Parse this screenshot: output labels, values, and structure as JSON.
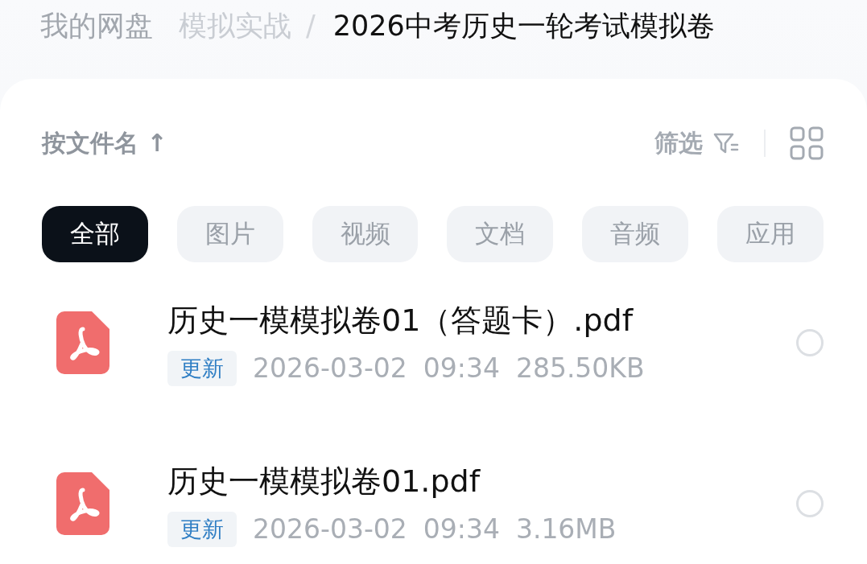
{
  "breadcrumb": [
    {
      "label": "我的网盘",
      "kind": "link"
    },
    {
      "label": "模拟实战",
      "kind": "link"
    },
    {
      "label": "/",
      "kind": "separator"
    },
    {
      "label": "2026中考历史一轮考试模拟卷",
      "kind": "current"
    }
  ],
  "sort": {
    "label": "按文件名 ↑"
  },
  "filter": {
    "label": "筛选"
  },
  "tabs": [
    {
      "label": "全部",
      "selected": true
    },
    {
      "label": "图片",
      "selected": false
    },
    {
      "label": "视频",
      "selected": false
    },
    {
      "label": "文档",
      "selected": false
    },
    {
      "label": "音频",
      "selected": false
    },
    {
      "label": "应用",
      "selected": false
    }
  ],
  "files": [
    {
      "name": "历史一模模拟卷01（答题卡）.pdf",
      "badge": "更新",
      "date": "2026-03-02",
      "time": "09:34",
      "size": "285.50KB",
      "selected": false
    },
    {
      "name": "历史一模模拟卷01.pdf",
      "badge": "更新",
      "date": "2026-03-02",
      "time": "09:34",
      "size": "3.16MB",
      "selected": false
    }
  ]
}
